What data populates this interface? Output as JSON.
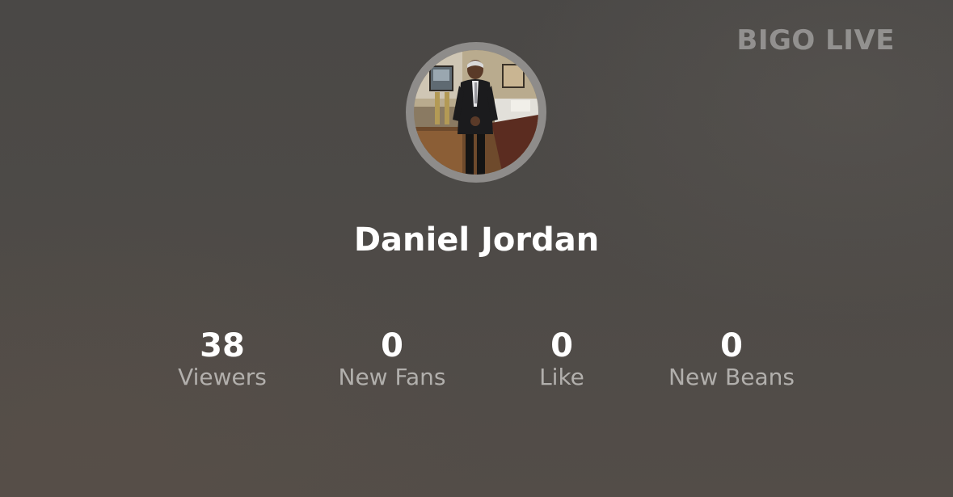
{
  "brand": "BIGO LIVE",
  "profile": {
    "name": "Daniel Jordan",
    "avatar_icon": "profile-photo"
  },
  "stats": [
    {
      "value": "38",
      "label": "Viewers"
    },
    {
      "value": "0",
      "label": "New Fans"
    },
    {
      "value": "0",
      "label": "Like"
    },
    {
      "value": "0",
      "label": "New Beans"
    }
  ]
}
